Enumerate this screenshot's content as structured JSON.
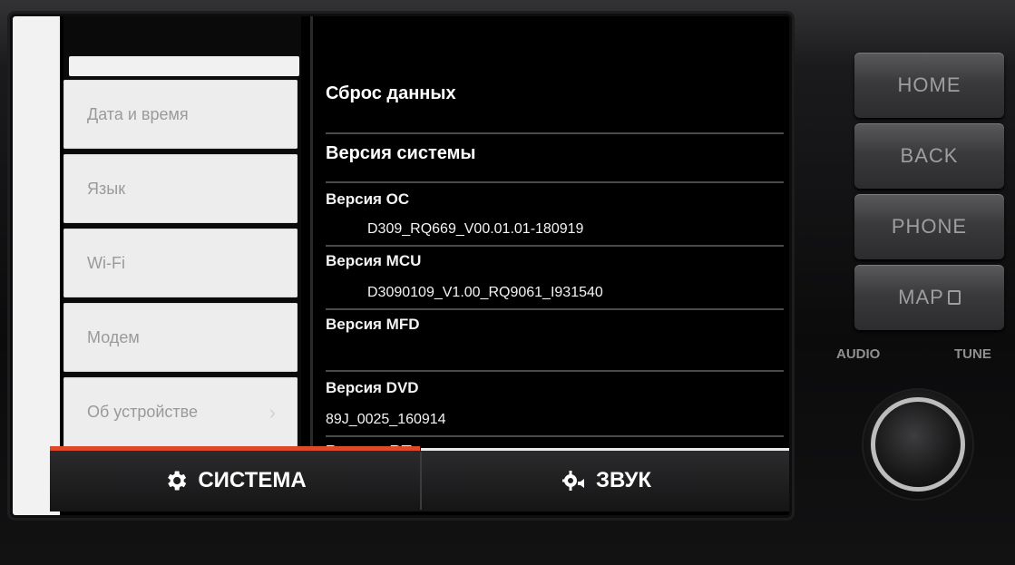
{
  "sidebar": {
    "items": [
      {
        "label": "Дата и время"
      },
      {
        "label": "Язык"
      },
      {
        "label": "Wi-Fi"
      },
      {
        "label": "Модем"
      },
      {
        "label": "Об устройстве",
        "chevron": "›"
      }
    ]
  },
  "content": {
    "reset_label": "Сброс данных",
    "system_version_label": "Версия системы",
    "os_version_label": "Версия ОС",
    "os_version_value": "D309_RQ669_V00.01.01-180919",
    "mcu_version_label": "Версия MCU",
    "mcu_version_value": "D3090109_V1.00_RQ9061_I931540",
    "mfd_version_label": "Версия MFD",
    "dvd_version_label": "Версия DVD",
    "dvd_version_value": "89J_0025_160914",
    "cut_off_label": "Версия BT"
  },
  "bottom_tabs": {
    "system_label": "СИСТЕМА",
    "sound_label": "ЗВУК",
    "active_color": "#e0482a"
  },
  "hardware": {
    "home_label": "HOME",
    "back_label": "BACK",
    "phone_label": "PHONE",
    "map_label": "MAP",
    "audio_label": "AUDIO",
    "tune_label": "TUNE"
  },
  "icons": {
    "system_icon": "gear-icon",
    "sound_icon": "sound-settings-icon",
    "chevron": "chevron-right-icon",
    "map_glyph": "map-icon"
  }
}
